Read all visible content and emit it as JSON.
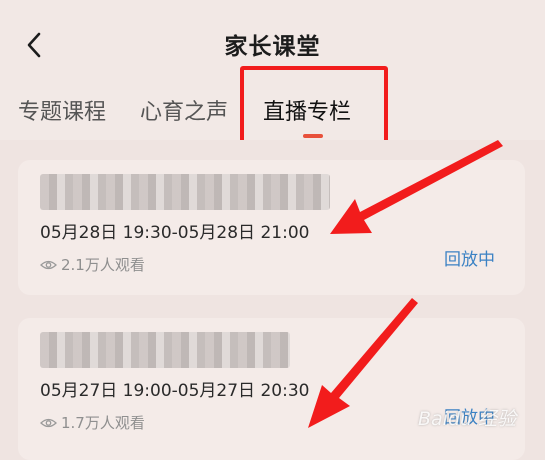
{
  "header": {
    "title": "家长课堂"
  },
  "tabs": [
    {
      "label": "专题课程"
    },
    {
      "label": "心育之声"
    },
    {
      "label": "直播专栏"
    }
  ],
  "cards": [
    {
      "time": "05月28日 19:30-05月28日 21:00",
      "views": "2.1万人观看",
      "status": "回放中"
    },
    {
      "time": "05月27日 19:00-05月27日 20:30",
      "views": "1.7万人观看",
      "status": "回放中"
    }
  ],
  "watermark": "Baidu 经验",
  "colors": {
    "accent": "#e8513b",
    "link": "#3b82c4",
    "annotation": "#f21c1c"
  }
}
